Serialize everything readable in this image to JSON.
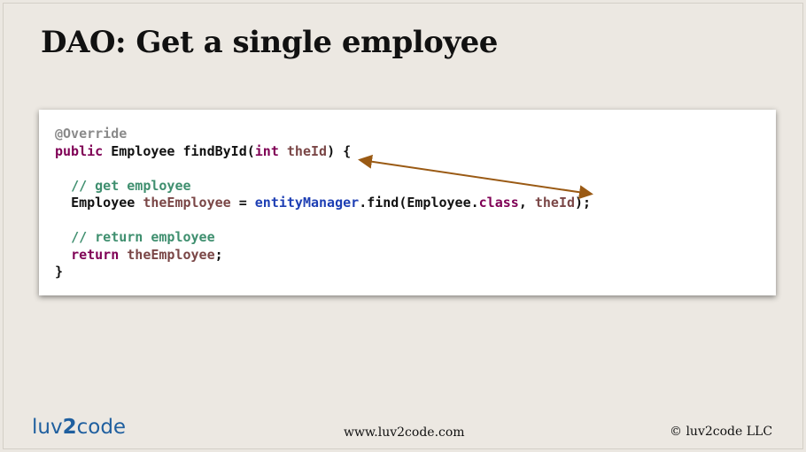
{
  "slide": {
    "title": "DAO: Get a single employee"
  },
  "code": {
    "line1": "@Override",
    "line2": {
      "kw_public": "public",
      "text1": " Employee findById(",
      "kw_int": "int",
      "sp": " ",
      "var_theId": "theId",
      "text2": ") {"
    },
    "line3_comment": "// get employee",
    "line4": {
      "text1": "Employee ",
      "var_theEmployee": "theEmployee",
      "text2": " = ",
      "field_entityManager": "entityManager",
      "text3": ".find(Employee.",
      "kw_class": "class",
      "text4": ", ",
      "var_theId": "theId",
      "text5": ");"
    },
    "line5_comment": "// return employee",
    "line6": {
      "kw_return": "return",
      "sp": " ",
      "var_theEmployee": "theEmployee",
      "text1": ";"
    },
    "line7": "}"
  },
  "colors": {
    "keyword": "#7f0055",
    "variable": "#7a4646",
    "comment": "#3f8f6f",
    "field": "#1e3fb4",
    "annotation": "#8a8a8a",
    "arrow": "#9a5a14"
  },
  "footer": {
    "logo_left": "luv",
    "logo_two": "2",
    "logo_right": "code",
    "url": "www.luv2code.com",
    "copyright": "© luv2code LLC"
  }
}
